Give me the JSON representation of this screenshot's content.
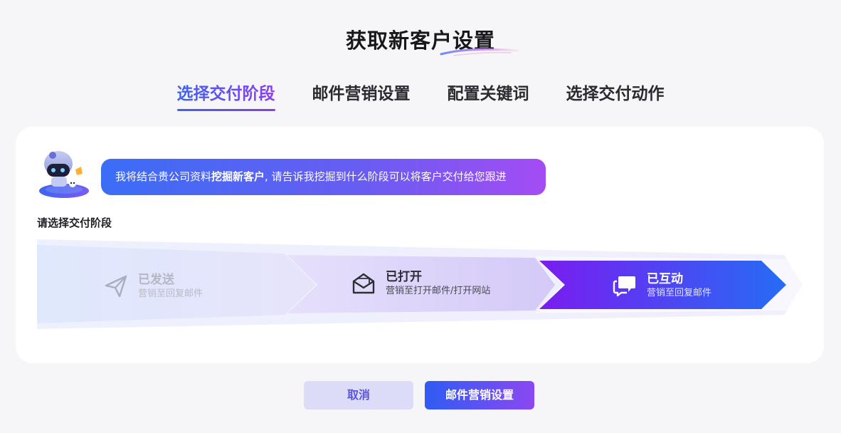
{
  "header": {
    "title": "获取新客户设置"
  },
  "tabs": [
    {
      "label": "选择交付阶段",
      "active": true
    },
    {
      "label": "邮件营销设置",
      "active": false
    },
    {
      "label": "配置关键词",
      "active": false
    },
    {
      "label": "选择交付动作",
      "active": false
    }
  ],
  "assistant": {
    "message_before": "我将结合贵公司资料",
    "message_bold": "挖掘新客户",
    "message_after": ", 请告诉我挖掘到什么阶段可以将客户交付给您跟进"
  },
  "section": {
    "label": "请选择交付阶段"
  },
  "stages": [
    {
      "title": "已发送",
      "subtitle": "营销至回复邮件",
      "icon": "send-icon",
      "state": "disabled"
    },
    {
      "title": "已打开",
      "subtitle": "营销至打开邮件/打开网站",
      "icon": "envelope-open-icon",
      "state": "default"
    },
    {
      "title": "已互动",
      "subtitle": "营销至回复邮件",
      "icon": "chat-bubbles-icon",
      "state": "selected"
    }
  ],
  "footer": {
    "cancel_label": "取消",
    "next_label": "邮件营销设置"
  },
  "colors": {
    "accent_blue": "#3b63f5",
    "accent_purple": "#8a3cf0",
    "page_background": "#f6f6f8"
  }
}
